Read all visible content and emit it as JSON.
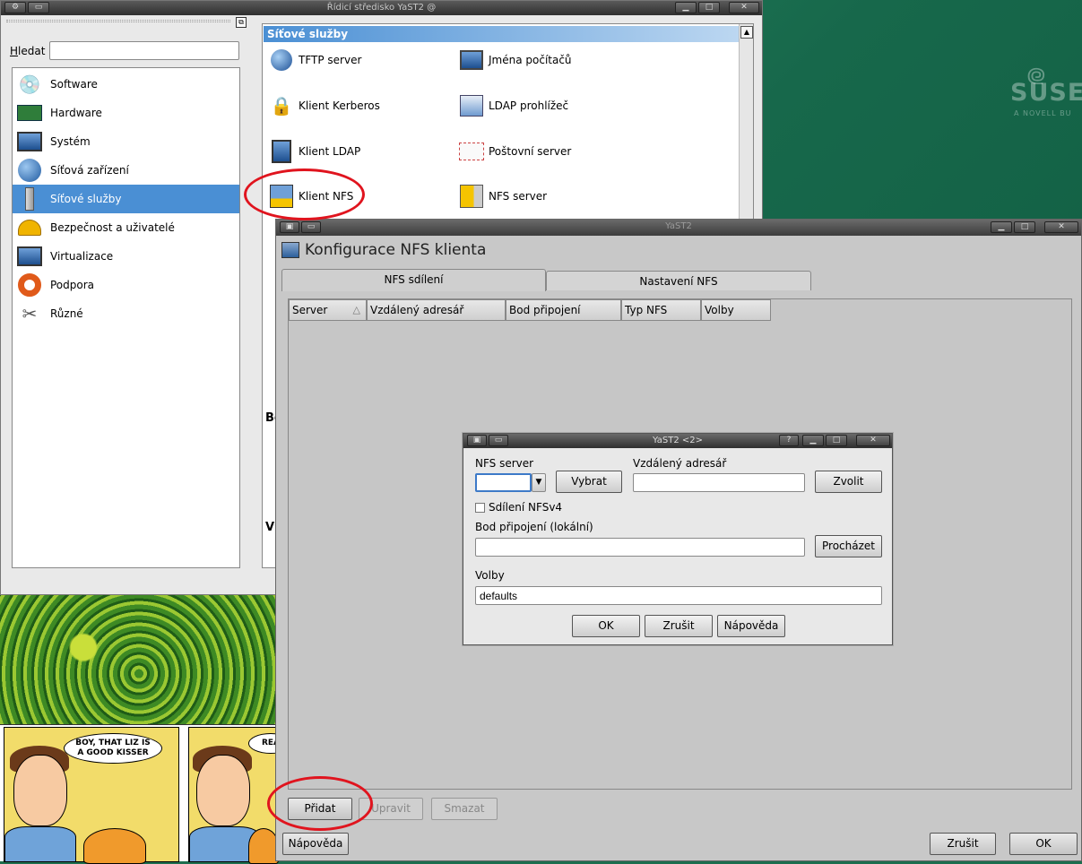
{
  "control_center": {
    "title": "Řídicí středisko YaST2 @",
    "search_label": "Hledat",
    "search_value": "",
    "categories": [
      {
        "label": "Software",
        "icon": "software-cd-icon"
      },
      {
        "label": "Hardware",
        "icon": "hardware-board-icon"
      },
      {
        "label": "Systém",
        "icon": "monitor-icon"
      },
      {
        "label": "Síťová zařízení",
        "icon": "network-globe-icon"
      },
      {
        "label": "Síťové služby",
        "icon": "network-services-icon",
        "selected": true
      },
      {
        "label": "Bezpečnost a uživatelé",
        "icon": "helmet-icon"
      },
      {
        "label": "Virtualizace",
        "icon": "virtualization-icon"
      },
      {
        "label": "Podpora",
        "icon": "lifebuoy-icon"
      },
      {
        "label": "Různé",
        "icon": "tools-icon"
      }
    ],
    "modules_header": "Síťové služby",
    "modules": [
      {
        "label": "TFTP server",
        "icon": "globe-icon"
      },
      {
        "label": "Jména počítačů",
        "icon": "computer-icon"
      },
      {
        "label": "Klient Kerberos",
        "icon": "padlock-icon"
      },
      {
        "label": "LDAP prohlížeč",
        "icon": "ldap-browser-icon"
      },
      {
        "label": "Klient LDAP",
        "icon": "monitor-icon"
      },
      {
        "label": "Poštovní server",
        "icon": "envelope-icon"
      },
      {
        "label": "Klient NFS",
        "icon": "nfs-folder-icon"
      },
      {
        "label": "NFS server",
        "icon": "nfs-server-icon"
      }
    ],
    "partial_headings": [
      "Bo",
      "Vi"
    ]
  },
  "nfs_window": {
    "title": "YaST2",
    "heading": "Konfigurace NFS klienta",
    "tabs": [
      {
        "label": "NFS sdílení",
        "active": true
      },
      {
        "label": "Nastavení NFS",
        "active": false
      }
    ],
    "columns": [
      "Server",
      "Vzdálený adresář",
      "Bod připojení",
      "Typ NFS",
      "Volby"
    ],
    "buttons": {
      "add": "Přidat",
      "edit": "Upravit",
      "delete": "Smazat",
      "help": "Nápověda",
      "cancel": "Zrušit",
      "ok": "OK"
    }
  },
  "dialog": {
    "title": "YaST2 <2>",
    "nfs_server_label": "NFS server",
    "nfs_server_value": "",
    "choose_button": "Vybrat",
    "remote_dir_label": "Vzdálený adresář",
    "remote_dir_value": "",
    "select_button": "Zvolit",
    "nfsv4_label": "Sdílení NFSv4",
    "nfsv4_checked": false,
    "mount_point_label": "Bod připojení (lokální)",
    "mount_point_value": "",
    "browse_button": "Procházet",
    "options_label": "Volby",
    "options_value": "defaults",
    "ok_button": "OK",
    "cancel_button": "Zrušit",
    "help_button": "Nápověda"
  },
  "desktop": {
    "logo_text": "SUSE",
    "logo_subtext": "A NOVELL BU",
    "comic_bubble_1": "BOY, THAT LIZ IS A GOOD KISSER",
    "comic_bubble_2": "REA"
  },
  "colors": {
    "selection": "#4a8fd4",
    "highlight_ring": "#e0141e"
  }
}
